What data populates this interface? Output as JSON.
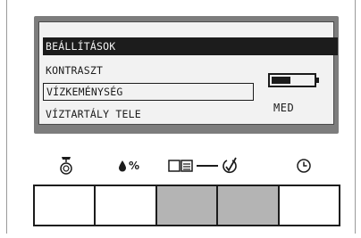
{
  "display": {
    "menu_title": "BEÁLLÍTÁSOK",
    "items": [
      {
        "label": "KONTRASZT",
        "selected": false
      },
      {
        "label": "VÍZKEMÉNYSÉG",
        "selected": true
      },
      {
        "label": "VÍZTARTÁLY TELE",
        "selected": false
      }
    ],
    "level": {
      "value_fraction": 0.45,
      "label": "MED"
    }
  },
  "icons": [
    {
      "name": "descale-icon"
    },
    {
      "name": "water-hardness-icon",
      "text": "%"
    },
    {
      "name": "menu-book-icon"
    },
    {
      "name": "confirm-check-icon"
    },
    {
      "name": "clock-icon"
    }
  ],
  "buttons": [
    {
      "name": "button-1",
      "shade": "white"
    },
    {
      "name": "button-2",
      "shade": "white"
    },
    {
      "name": "button-3",
      "shade": "gray"
    },
    {
      "name": "button-4",
      "shade": "gray"
    },
    {
      "name": "button-5",
      "shade": "white"
    }
  ],
  "colors": {
    "screen_bg": "#f2f2f2",
    "bezel": "#7d7d7d",
    "text": "#1c1c1c",
    "button_gray": "#b4b4b4"
  }
}
